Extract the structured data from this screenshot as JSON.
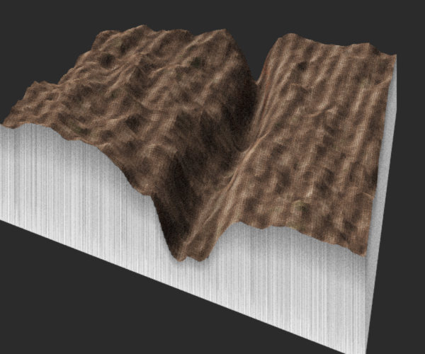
{
  "scene": {
    "background_color": "#2b2b2b",
    "skirt_color": "#f2f2f2",
    "rock_palette": [
      "#2a2320",
      "#4a3a30",
      "#6b5243",
      "#8b6b55",
      "#a88a72",
      "#c2ab94",
      "#d8cbbb"
    ],
    "vegetation_color": "#5c6a3a",
    "feature": "canyon"
  }
}
